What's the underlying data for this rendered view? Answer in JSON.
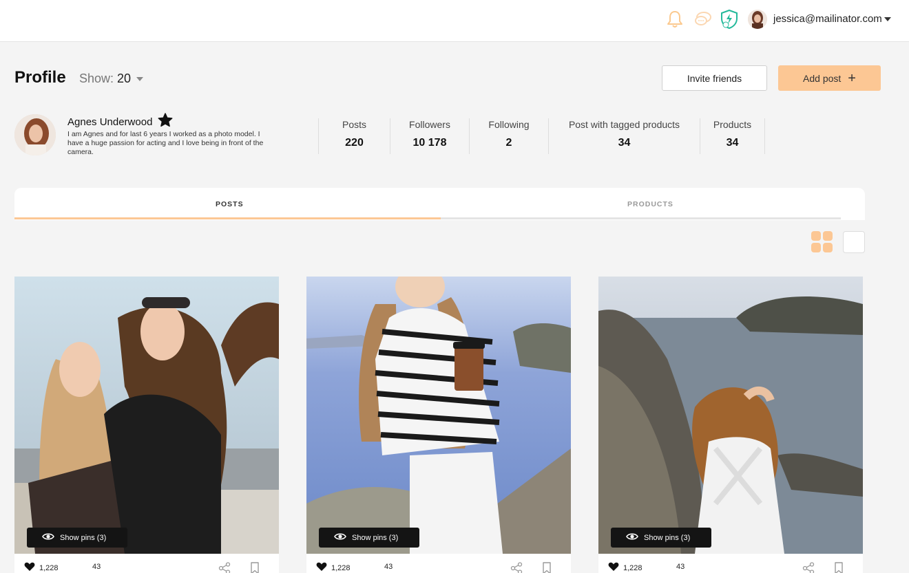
{
  "header": {
    "user_email": "jessica@mailinator.com",
    "icons": [
      "bell-icon",
      "chat-icon",
      "shield-bolt-icon",
      "avatar",
      "caret-down-icon"
    ]
  },
  "page": {
    "title": "Profile",
    "show_label": "Show:",
    "show_value": "20"
  },
  "actions": {
    "invite_label": "Invite friends",
    "add_post_label": "Add post"
  },
  "profile": {
    "name": "Agnes Underwood",
    "bio": "I am Agnes and for last 6 years I worked as a photo model. I have a huge passion for acting and I love being in front of the camera."
  },
  "stats": [
    {
      "label": "Posts",
      "value": "220"
    },
    {
      "label": "Followers",
      "value": "10 178"
    },
    {
      "label": "Following",
      "value": "2"
    },
    {
      "label": "Post with tagged products",
      "value": "34"
    },
    {
      "label": "Products",
      "value": "34"
    }
  ],
  "tabs": [
    {
      "label": "POSTS",
      "active": true
    },
    {
      "label": "PRODUCTS",
      "active": false
    }
  ],
  "posts": [
    {
      "pins_label": "Show pins (3)",
      "likes": "1,228",
      "comments": "43"
    },
    {
      "pins_label": "Show pins (3)",
      "likes": "1,228",
      "comments": "43"
    },
    {
      "pins_label": "Show pins (3)",
      "likes": "1,228",
      "comments": "43"
    }
  ],
  "colors": {
    "accent": "#fcc794",
    "shield": "#23b99a",
    "icon_muted": "#fbd7b2"
  }
}
